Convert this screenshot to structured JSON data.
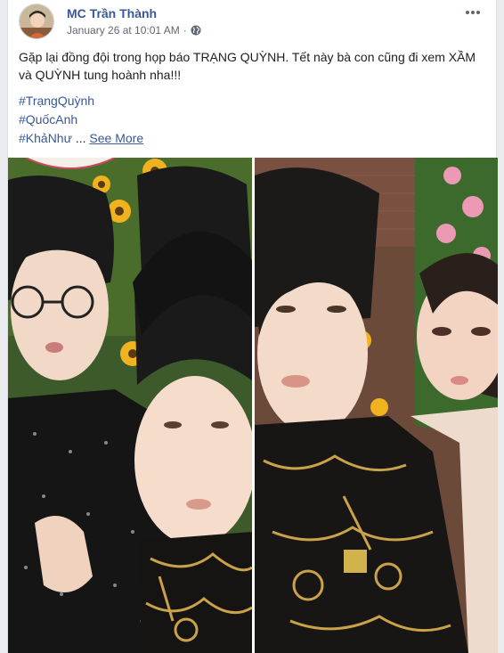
{
  "post": {
    "author": "MC Trần Thành",
    "timestamp": "January 26 at 10:01 AM",
    "separator": "·",
    "privacy_icon": "globe-icon",
    "options_icon": "more-options-icon",
    "text": "Gặp lại đồng đội trong họp báo TRẠNG QUỲNH. Tết này bà con cũng đi xem XẦM và QUỲNH tung hoành nha!!!",
    "tags": [
      "#TrạngQuỳnh",
      "#QuốcAnh",
      "#KhảNhư"
    ],
    "ellipsis": "...",
    "see_more": "See More"
  },
  "colors": {
    "link": "#385898",
    "meta": "#616770",
    "background": "#e9ebee",
    "card": "#ffffff"
  }
}
